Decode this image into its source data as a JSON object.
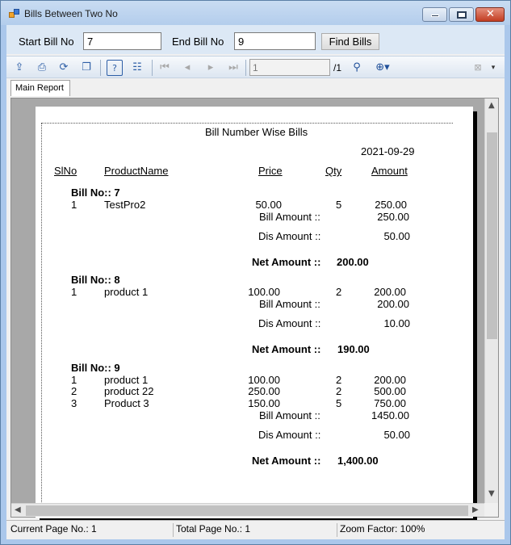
{
  "window": {
    "title": "Bills Between Two No"
  },
  "form": {
    "start_label": "Start Bill No",
    "start_value": "7",
    "end_label": "End Bill No",
    "end_value": "9",
    "find_button": "Find Bills"
  },
  "toolbar": {
    "page_value": "1",
    "page_total": "/1",
    "icons": [
      "export-icon",
      "print-icon",
      "refresh-icon",
      "copy-icon",
      "help-icon",
      "group-tree-icon",
      "first-page-icon",
      "prev-page-icon",
      "next-page-icon",
      "last-page-icon",
      "find-icon",
      "zoom-icon",
      "close-icon"
    ]
  },
  "tabs": [
    {
      "label": "Main Report"
    }
  ],
  "report": {
    "title": "Bill Number Wise Bills",
    "date": "2021-09-29",
    "headers": {
      "slno": "SlNo",
      "product": "ProductName",
      "price": "Price",
      "qty": "Qty",
      "amount": "Amount"
    },
    "bills": [
      {
        "heading": "Bill No:: 7",
        "items": [
          {
            "slno": "1",
            "product": "TestPro2",
            "price": "50.00",
            "qty": "5",
            "amount": "250.00"
          }
        ],
        "bill_amount_label": "Bill Amount ::",
        "bill_amount": "250.00",
        "dis_amount_label": "Dis Amount ::",
        "dis_amount": "50.00",
        "net_amount_label": "Net Amount ::",
        "net_amount": "200.00"
      },
      {
        "heading": "Bill No:: 8",
        "items": [
          {
            "slno": "1",
            "product": "product 1",
            "price": "100.00",
            "qty": "2",
            "amount": "200.00"
          }
        ],
        "bill_amount_label": "Bill Amount ::",
        "bill_amount": "200.00",
        "dis_amount_label": "Dis Amount ::",
        "dis_amount": "10.00",
        "net_amount_label": "Net Amount ::",
        "net_amount": "190.00"
      },
      {
        "heading": "Bill No:: 9",
        "items": [
          {
            "slno": "1",
            "product": "product 1",
            "price": "100.00",
            "qty": "2",
            "amount": "200.00"
          },
          {
            "slno": "2",
            "product": "product 22",
            "price": "250.00",
            "qty": "2",
            "amount": "500.00"
          },
          {
            "slno": "3",
            "product": "Product 3",
            "price": "150.00",
            "qty": "5",
            "amount": "750.00"
          }
        ],
        "bill_amount_label": "Bill Amount ::",
        "bill_amount": "1450.00",
        "dis_amount_label": "Dis Amount ::",
        "dis_amount": "50.00",
        "net_amount_label": "Net Amount ::",
        "net_amount": "1,400.00"
      }
    ]
  },
  "status": {
    "current_page": "Current Page No.: 1",
    "total_page": "Total Page No.: 1",
    "zoom": "Zoom Factor: 100%"
  }
}
